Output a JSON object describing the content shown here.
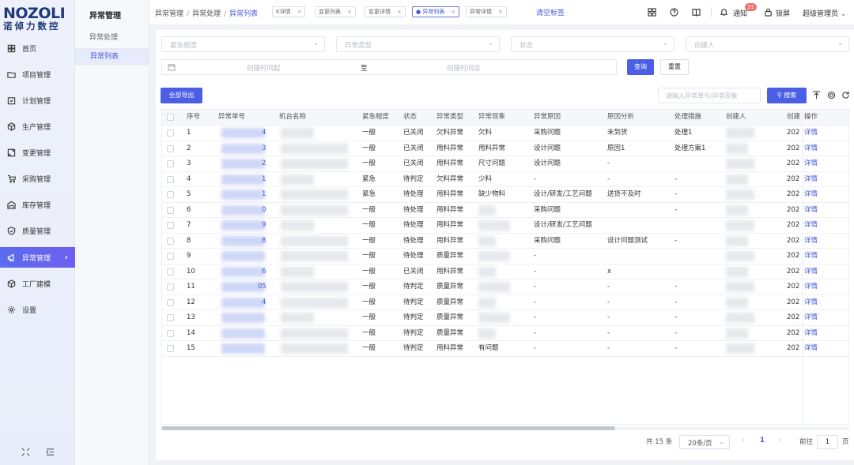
{
  "logo": {
    "en": "NOZOLI",
    "cn": "诺倬力数控"
  },
  "nav": {
    "items": [
      {
        "label": "首页",
        "icon": "home-icon"
      },
      {
        "label": "项目管理",
        "icon": "folder-icon"
      },
      {
        "label": "计划管理",
        "icon": "calendar-check-icon"
      },
      {
        "label": "生产管理",
        "icon": "cube-icon"
      },
      {
        "label": "变更管理",
        "icon": "swap-icon"
      },
      {
        "label": "采购管理",
        "icon": "cart-icon"
      },
      {
        "label": "库存管理",
        "icon": "warehouse-icon"
      },
      {
        "label": "质量管理",
        "icon": "shield-icon"
      },
      {
        "label": "异常管理",
        "icon": "megaphone-icon",
        "active": true
      },
      {
        "label": "工厂建模",
        "icon": "box-3d-icon"
      },
      {
        "label": "设置",
        "icon": "gear-icon"
      }
    ]
  },
  "subnav": {
    "title": "异常管理",
    "items": [
      "异常处理",
      "异常列表"
    ]
  },
  "header": {
    "breadcrumb": [
      "异常管理",
      "异常处理",
      "异常列表"
    ],
    "tags": [
      {
        "label": "K详情"
      },
      {
        "label": "变更列表"
      },
      {
        "label": "变更详情"
      },
      {
        "label": "● 异常列表",
        "active": true
      },
      {
        "label": "异常详情"
      }
    ],
    "clear_tags": "清空标签",
    "notify_label": "通知",
    "notify_count": "31",
    "lock_label": "锁屏",
    "user_label": "超级管理员"
  },
  "filters": {
    "urgency": "紧急程度",
    "type": "异常类型",
    "status": "状态",
    "creator": "创建人",
    "date_start": "创建时间起",
    "date_to": "至",
    "date_end": "创建时间迄",
    "query": "查询",
    "reset": "重置"
  },
  "toolbar": {
    "export_all": "全部导出",
    "search_placeholder": "请输入异常单号/异常现象",
    "search": "搜索"
  },
  "table": {
    "columns": [
      "序号",
      "异常单号",
      "机台名称",
      "紧急程度",
      "状态",
      "异常类型",
      "异常现象",
      "异常原因",
      "原因分析",
      "处理措施",
      "创建人",
      "创建",
      "操作"
    ],
    "rows": [
      {
        "no": "1",
        "id_tail": "4",
        "urgency": "一般",
        "status": "已关闭",
        "type": "欠料异常",
        "phen": "欠料",
        "cause": "采购问题",
        "analysis": "未到货",
        "measure": "处理1",
        "created": "202",
        "op": "详情"
      },
      {
        "no": "2",
        "id_tail": "3",
        "urgency": "一般",
        "status": "已关闭",
        "type": "用料异常",
        "phen": "用料异常",
        "cause": "设计问题",
        "analysis": "原因1",
        "measure": "处理方案1",
        "created": "202",
        "op": "详情"
      },
      {
        "no": "3",
        "id_tail": "2",
        "urgency": "一般",
        "status": "已关闭",
        "type": "用料异常",
        "phen": "尺寸问题",
        "cause": "设计问题",
        "analysis": "-",
        "measure": "",
        "created": "202",
        "op": "详情"
      },
      {
        "no": "4",
        "id_tail": "1",
        "urgency": "紧急",
        "status": "待判定",
        "type": "欠料异常",
        "phen": "少料",
        "cause": "-",
        "analysis": "-",
        "measure": "-",
        "created": "202",
        "op": "详情"
      },
      {
        "no": "5",
        "id_tail": "1",
        "urgency": "紧急",
        "status": "待处理",
        "type": "用料异常",
        "phen": "缺少物料",
        "cause": "设计/研发/工艺问题",
        "analysis": "送货不及时",
        "measure": "-",
        "created": "202",
        "op": "详情"
      },
      {
        "no": "6",
        "id_tail": "0",
        "urgency": "一般",
        "status": "待处理",
        "type": "用料异常",
        "phen": "",
        "cause": "采购问题",
        "analysis": "",
        "measure": "-",
        "created": "202",
        "op": "详情"
      },
      {
        "no": "7",
        "id_tail": "9",
        "urgency": "一般",
        "status": "待处理",
        "type": "用料异常",
        "phen": "",
        "cause": "设计/研发/工艺问题",
        "analysis": "",
        "measure": "",
        "created": "202",
        "op": "详情"
      },
      {
        "no": "8",
        "id_tail": "8",
        "urgency": "一般",
        "status": "待处理",
        "type": "用料异常",
        "phen": "",
        "cause": "采购问题",
        "analysis": "设计问题测试",
        "measure": "-",
        "created": "202",
        "op": "详情"
      },
      {
        "no": "9",
        "id_tail": "",
        "urgency": "一般",
        "status": "待处理",
        "type": "质量异常",
        "phen": "",
        "cause": "-",
        "analysis": "",
        "measure": "",
        "created": "202",
        "op": "详情"
      },
      {
        "no": "10",
        "id_tail": "6",
        "urgency": "一般",
        "status": "已关闭",
        "type": "用料异常",
        "phen": "",
        "cause": "-",
        "analysis": "x",
        "measure": "",
        "created": "202",
        "op": "详情"
      },
      {
        "no": "11",
        "id_tail": "05",
        "urgency": "一般",
        "status": "待判定",
        "type": "质量异常",
        "phen": "",
        "cause": "-",
        "analysis": "-",
        "measure": "-",
        "created": "202",
        "op": "详情"
      },
      {
        "no": "12",
        "id_tail": "4",
        "urgency": "一般",
        "status": "待判定",
        "type": "质量异常",
        "phen": "",
        "cause": "-",
        "analysis": "-",
        "measure": "-",
        "created": "202",
        "op": "详情"
      },
      {
        "no": "13",
        "id_tail": "",
        "urgency": "一般",
        "status": "待判定",
        "type": "质量异常",
        "phen": "",
        "cause": "-",
        "analysis": "-",
        "measure": "-",
        "created": "202",
        "op": "详情"
      },
      {
        "no": "14",
        "id_tail": "",
        "urgency": "一般",
        "status": "待判定",
        "type": "质量异常",
        "phen": "",
        "cause": "-",
        "analysis": "-",
        "measure": "-",
        "created": "202",
        "op": "详情"
      },
      {
        "no": "15",
        "id_tail": "",
        "urgency": "一般",
        "status": "待判定",
        "type": "用料异常",
        "phen": "有问题",
        "cause": "-",
        "analysis": "-",
        "measure": "-",
        "created": "202",
        "op": "详情"
      }
    ]
  },
  "pager": {
    "total": "共 15 条",
    "page_size": "20条/页",
    "current_page": "1",
    "goto_label": "前往",
    "goto_value": "1",
    "page_unit": "页",
    "prev": "‹",
    "next": "›"
  },
  "colors": {
    "accent": "#4b5ee4",
    "link": "#4459d6",
    "active_nav": "#5a6cf0",
    "badge": "#f56c6c"
  }
}
